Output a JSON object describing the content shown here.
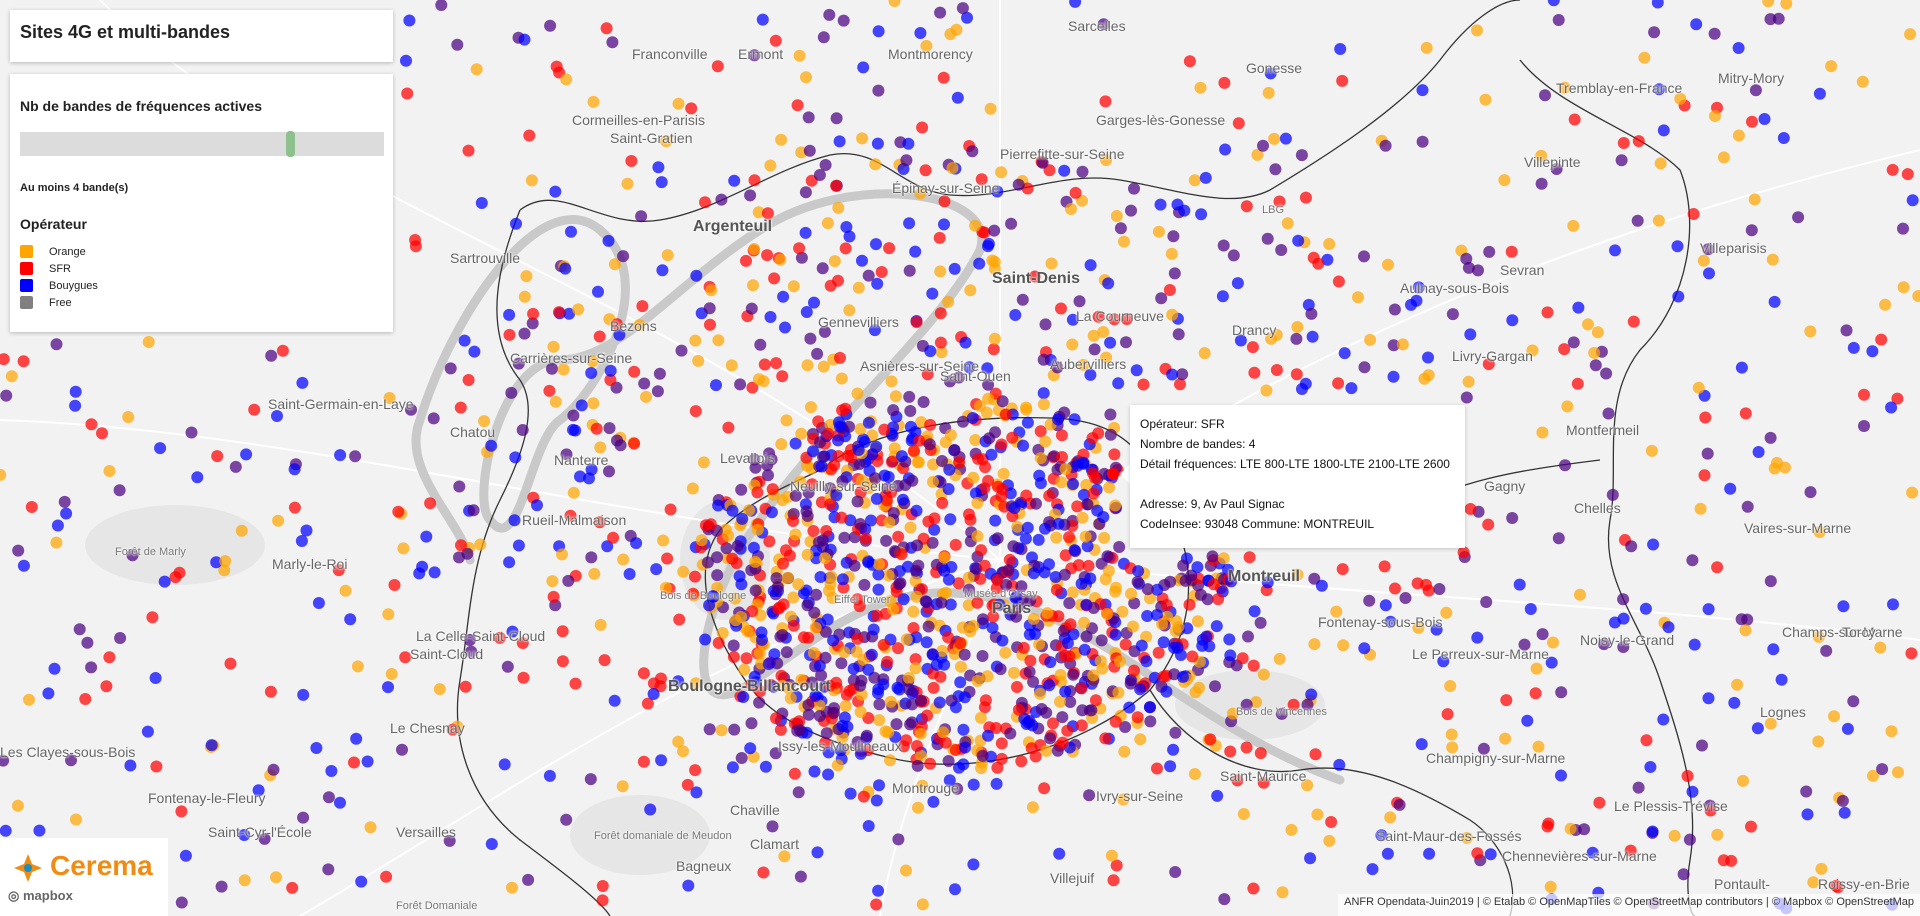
{
  "app": {
    "title": "Sites 4G et multi-bandes"
  },
  "filter": {
    "slider_label": "Nb de bandes de fréquences actives",
    "value_text": "Au moins 4 bande(s)",
    "min_bands": 4
  },
  "legend": {
    "title": "Opérateur",
    "items": [
      {
        "label": "Orange",
        "color": "#ffa500"
      },
      {
        "label": "SFR",
        "color": "#ff0000"
      },
      {
        "label": "Bouygues",
        "color": "#0000ff"
      },
      {
        "label": "Free",
        "color": "#808080"
      }
    ]
  },
  "popup": {
    "operator": "Opérateur: SFR",
    "bands": "Nombre de bandes: 4",
    "frequencies": "Détail fréquences: LTE 800-LTE 1800-LTE 2100-LTE 2600",
    "address": "Adresse: 9, Av Paul Signac",
    "insee": "CodeInsee: 93048 Commune: MONTREUIL"
  },
  "logo": {
    "name": "Cerema",
    "mapbox": "mapbox"
  },
  "attribution": "ANFR Opendata-Juin2019 | © Etalab © OpenMapTiles © OpenStreetMap contributors | © Mapbox © OpenStreetMap",
  "places": [
    {
      "name": "Franconville",
      "size": "normal"
    },
    {
      "name": "Ermont",
      "size": "normal"
    },
    {
      "name": "Montmorency",
      "size": "normal"
    },
    {
      "name": "Sarcelles",
      "size": "normal"
    },
    {
      "name": "Gonesse",
      "size": "normal"
    },
    {
      "name": "Tremblay-en-France",
      "size": "normal"
    },
    {
      "name": "Mitry-Mory",
      "size": "normal"
    },
    {
      "name": "Cormeilles-en-Parisis",
      "size": "normal"
    },
    {
      "name": "Saint-Gratien",
      "size": "normal"
    },
    {
      "name": "Pierrefitte-sur-Seine",
      "size": "normal"
    },
    {
      "name": "Garges-lès-Gonesse",
      "size": "normal"
    },
    {
      "name": "Villepinte",
      "size": "normal"
    },
    {
      "name": "Argenteuil",
      "size": "big"
    },
    {
      "name": "Épinay-sur-Seine",
      "size": "normal"
    },
    {
      "name": "LBG",
      "size": "small"
    },
    {
      "name": "Sartrouville",
      "size": "normal"
    },
    {
      "name": "Saint-Denis",
      "size": "big"
    },
    {
      "name": "Aulnay-sous-Bois",
      "size": "normal"
    },
    {
      "name": "Sevran",
      "size": "normal"
    },
    {
      "name": "Villeparisis",
      "size": "normal"
    },
    {
      "name": "Bezons",
      "size": "normal"
    },
    {
      "name": "Gennevilliers",
      "size": "normal"
    },
    {
      "name": "La Courneuve",
      "size": "normal"
    },
    {
      "name": "Drancy",
      "size": "normal"
    },
    {
      "name": "Carrières-sur-Seine",
      "size": "normal"
    },
    {
      "name": "Asnières-sur-Seine",
      "size": "normal"
    },
    {
      "name": "Saint-Ouen",
      "size": "normal"
    },
    {
      "name": "Aubervilliers",
      "size": "normal"
    },
    {
      "name": "Livry-Gargan",
      "size": "normal"
    },
    {
      "name": "Saint-Germain-en-Laye",
      "size": "normal"
    },
    {
      "name": "Chatou",
      "size": "normal"
    },
    {
      "name": "Montfermeil",
      "size": "normal"
    },
    {
      "name": "Nanterre",
      "size": "normal"
    },
    {
      "name": "Levallois",
      "size": "normal"
    },
    {
      "name": "Neuilly-sur-Seine",
      "size": "normal"
    },
    {
      "name": "Gagny",
      "size": "normal"
    },
    {
      "name": "Chelles",
      "size": "normal"
    },
    {
      "name": "Rueil-Malmaison",
      "size": "normal"
    },
    {
      "name": "Forêt de Marly",
      "size": "small"
    },
    {
      "name": "Marly-le-Roi",
      "size": "normal"
    },
    {
      "name": "Vaires-sur-Marne",
      "size": "normal"
    },
    {
      "name": "Montreuil",
      "size": "big"
    },
    {
      "name": "Bois de Boulogne",
      "size": "small"
    },
    {
      "name": "Paris",
      "size": "big"
    },
    {
      "name": "Musée d'Orsay",
      "size": "small"
    },
    {
      "name": "Eiffel Tower",
      "size": "small"
    },
    {
      "name": "Fontenay-sous-Bois",
      "size": "normal"
    },
    {
      "name": "Noisy-le-Grand",
      "size": "normal"
    },
    {
      "name": "Champs-sur-Marne",
      "size": "normal"
    },
    {
      "name": "Torcy",
      "size": "normal"
    },
    {
      "name": "La Celle-Saint-Cloud",
      "size": "normal"
    },
    {
      "name": "Saint-Cloud",
      "size": "normal"
    },
    {
      "name": "Le Perreux-sur-Marne",
      "size": "normal"
    },
    {
      "name": "Boulogne-Billancourt",
      "size": "big"
    },
    {
      "name": "Bois de Vincennes",
      "size": "small"
    },
    {
      "name": "Lognes",
      "size": "normal"
    },
    {
      "name": "Le Chesnay",
      "size": "normal"
    },
    {
      "name": "Les Clayes-sous-Bois",
      "size": "normal"
    },
    {
      "name": "Issy-les-Moulineaux",
      "size": "normal"
    },
    {
      "name": "Saint-Maurice",
      "size": "normal"
    },
    {
      "name": "Champigny-sur-Marne",
      "size": "normal"
    },
    {
      "name": "Fontenay-le-Fleury",
      "size": "normal"
    },
    {
      "name": "Montrouge",
      "size": "normal"
    },
    {
      "name": "Chaville",
      "size": "normal"
    },
    {
      "name": "Ivry-sur-Seine",
      "size": "normal"
    },
    {
      "name": "Le Plessis-Trévise",
      "size": "normal"
    },
    {
      "name": "Versailles",
      "size": "normal"
    },
    {
      "name": "Saint-Cyr-l'École",
      "size": "normal"
    },
    {
      "name": "Forêt domaniale de Meudon",
      "size": "small"
    },
    {
      "name": "Clamart",
      "size": "normal"
    },
    {
      "name": "Saint-Maur-des-Fossés",
      "size": "normal"
    },
    {
      "name": "Chennevières-sur-Marne",
      "size": "normal"
    },
    {
      "name": "Bagneux",
      "size": "normal"
    },
    {
      "name": "Villejuif",
      "size": "normal"
    },
    {
      "name": "Pontault-",
      "size": "normal"
    },
    {
      "name": "Roissy-en-Brie",
      "size": "normal"
    },
    {
      "name": "Forêt Domaniale",
      "size": "small"
    }
  ]
}
